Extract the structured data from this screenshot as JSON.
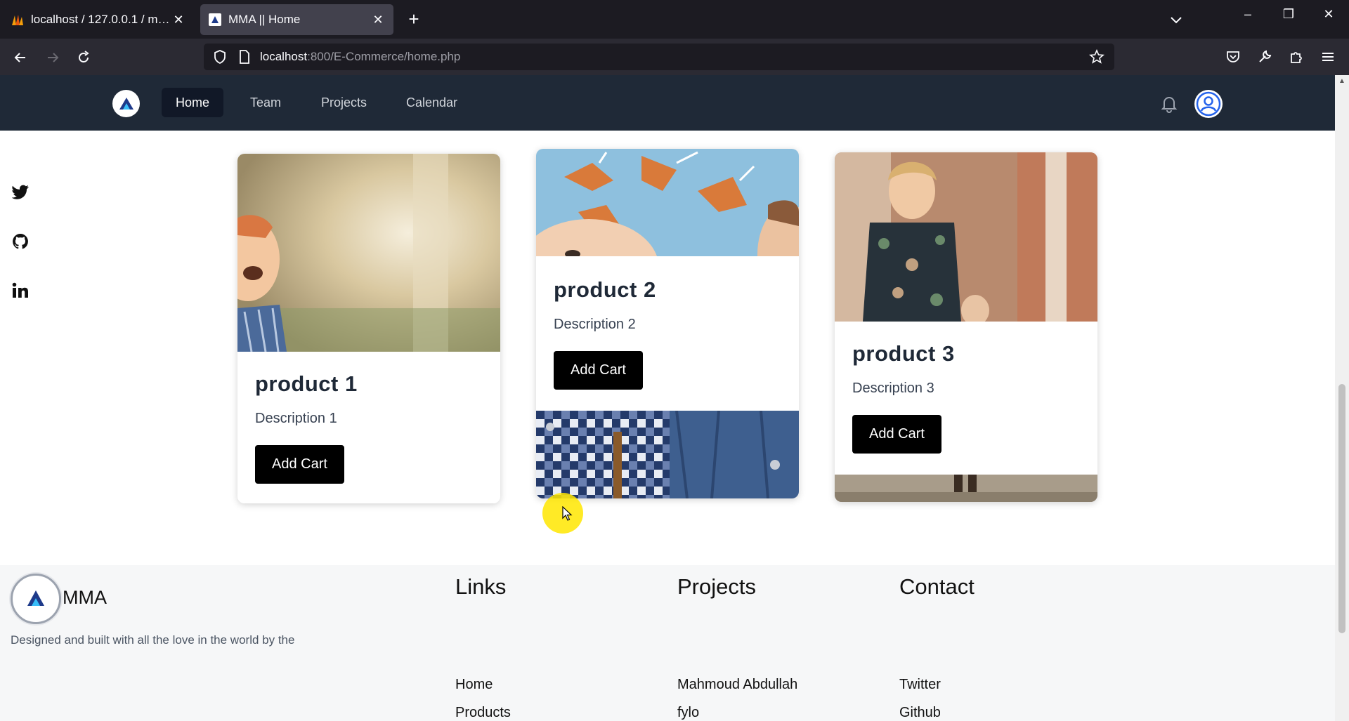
{
  "browser": {
    "tabs": [
      {
        "title": "localhost / 127.0.0.1 / mma / us",
        "active": false
      },
      {
        "title": "MMA || Home",
        "active": true
      }
    ],
    "url_host": "localhost",
    "url_rest": ":800/E-Commerce/home.php"
  },
  "site": {
    "nav": [
      "Home",
      "Team",
      "Projects",
      "Calendar"
    ],
    "current_nav": "Home"
  },
  "products": [
    {
      "name": "product 1",
      "description": "Description 1",
      "button": "Add Cart"
    },
    {
      "name": "product 2",
      "description": "Description 2",
      "button": "Add Cart"
    },
    {
      "name": "product 3",
      "description": "Description 3",
      "button": "Add Cart"
    }
  ],
  "footer": {
    "brand": "MMA",
    "tagline": "Designed and built with all the love in the world by the",
    "columns": [
      {
        "title": "Links",
        "items": [
          "Home",
          "Products"
        ]
      },
      {
        "title": "Projects",
        "items": [
          "Mahmoud Abdullah",
          "fylo"
        ]
      },
      {
        "title": "Contact",
        "items": [
          "Twitter",
          "Github"
        ]
      }
    ]
  },
  "colors": {
    "nav_bg": "#1f2937",
    "button_bg": "#000000",
    "cursor_halo": "#ffe600"
  }
}
